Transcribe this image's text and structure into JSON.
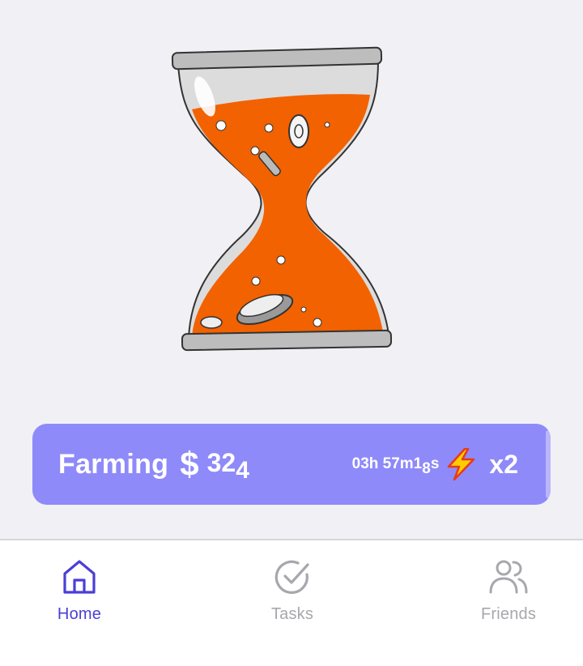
{
  "hero": {
    "icon": "hourglass-coins-illustration"
  },
  "farming": {
    "label": "Farming",
    "currency_icon": "$",
    "amount_main": "32",
    "amount_sub": "4",
    "timer_main": "03h 57m1",
    "timer_sub": "8",
    "timer_suffix": "s",
    "boost_icon": "lightning-bolt-icon",
    "multiplier": "x2",
    "colors": {
      "bar": "#8f8af9",
      "text": "#ffffff"
    }
  },
  "tabs": [
    {
      "label": "Home",
      "icon": "home-icon",
      "active": true
    },
    {
      "label": "Tasks",
      "icon": "check-circle-icon",
      "active": false
    },
    {
      "label": "Friends",
      "icon": "users-icon",
      "active": false
    }
  ],
  "colors": {
    "accent": "#4a3fd6",
    "inactive": "#a7a7ad",
    "sand": "#f26200",
    "background": "#f1f0f5"
  }
}
